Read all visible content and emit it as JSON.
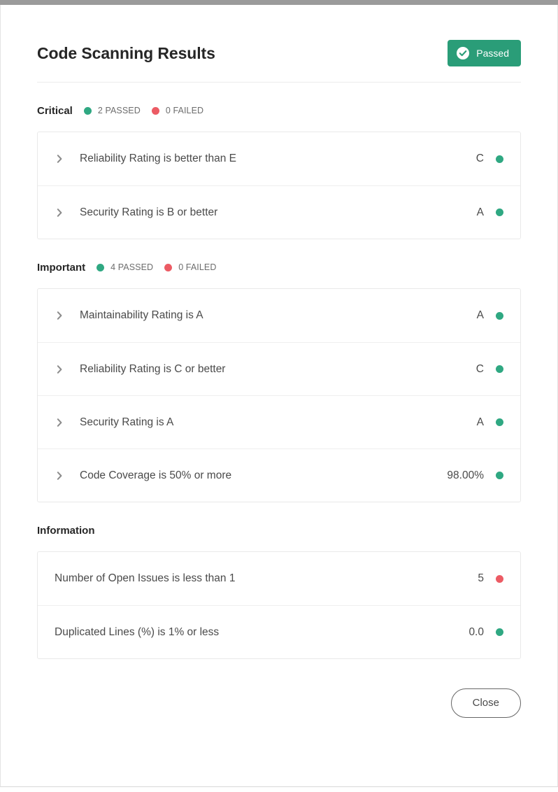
{
  "modal": {
    "title": "Code Scanning Results",
    "status_badge": {
      "label": "Passed",
      "icon": "check-circle-icon",
      "color": "#2a9d78"
    },
    "close_label": "Close"
  },
  "colors": {
    "pass": "#2fa882",
    "fail": "#ec5b64",
    "badge": "#2a9d78"
  },
  "sections": [
    {
      "title": "Critical",
      "passed_label": "2 PASSED",
      "failed_label": "0 FAILED",
      "has_counts": true,
      "rows": [
        {
          "label": "Reliability Rating is better than E",
          "value": "C",
          "status": "pass",
          "expandable": true
        },
        {
          "label": "Security Rating is B or better",
          "value": "A",
          "status": "pass",
          "expandable": true
        }
      ]
    },
    {
      "title": "Important",
      "passed_label": "4 PASSED",
      "failed_label": "0 FAILED",
      "has_counts": true,
      "rows": [
        {
          "label": "Maintainability Rating is A",
          "value": "A",
          "status": "pass",
          "expandable": true
        },
        {
          "label": "Reliability Rating is C or better",
          "value": "C",
          "status": "pass",
          "expandable": true
        },
        {
          "label": "Security Rating is A",
          "value": "A",
          "status": "pass",
          "expandable": true
        },
        {
          "label": "Code Coverage is 50% or more",
          "value": "98.00%",
          "status": "pass",
          "expandable": true
        }
      ]
    },
    {
      "title": "Information",
      "passed_label": "",
      "failed_label": "",
      "has_counts": false,
      "rows": [
        {
          "label": "Number of Open Issues is less than 1",
          "value": "5",
          "status": "fail",
          "expandable": false
        },
        {
          "label": "Duplicated Lines (%) is 1% or less",
          "value": "0.0",
          "status": "pass",
          "expandable": false
        }
      ]
    }
  ]
}
